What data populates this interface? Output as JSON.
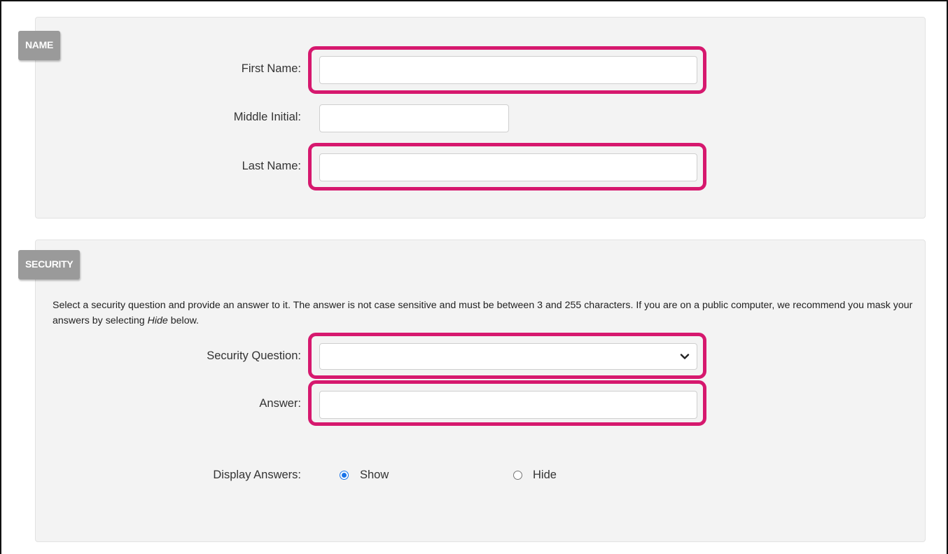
{
  "sections": {
    "name": {
      "title": "NAME",
      "first_name_label": "First Name:",
      "first_name_value": "",
      "middle_initial_label": "Middle Initial:",
      "middle_initial_value": "",
      "last_name_label": "Last Name:",
      "last_name_value": ""
    },
    "security": {
      "title": "SECURITY",
      "description_before": "Select a security question and provide an answer to it. The answer is not case sensitive and must be between 3 and 255 characters. If you are on a public computer, we recommend you mask your answers by selecting ",
      "description_emphasis": "Hide",
      "description_after": " below.",
      "question_label": "Security Question:",
      "question_selected": "",
      "answer_label": "Answer:",
      "answer_value": "",
      "display_label": "Display Answers:",
      "display_options": [
        "Show",
        "Hide"
      ],
      "display_selected": "Show"
    }
  },
  "colors": {
    "highlight": "#d6186e",
    "tag_background": "#9a9a9a",
    "panel_background": "#f3f3f3",
    "radio_checked": "#1a73e8"
  },
  "icons": {
    "select_arrow": "chevron-down-icon"
  }
}
